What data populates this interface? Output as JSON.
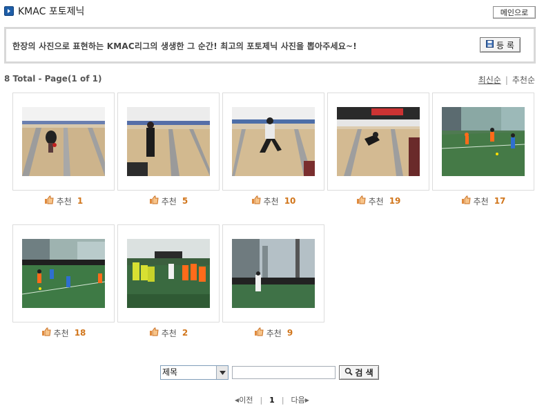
{
  "header": {
    "title": "KMAC 포토제닉",
    "main_button": "메인으로"
  },
  "notice": {
    "text": "한장의 사진으로 표현하는 KMAC리그의 생생한 그 순간!  최고의 포토제닉 사진을 뽑아주세요~!",
    "register_button": "등 록"
  },
  "summary": {
    "count_text": "8 Total - Page(1 of 1)"
  },
  "sort": {
    "latest": "최신순",
    "separator": "|",
    "recommended": "추천순"
  },
  "photos": [
    {
      "scene": "bowling",
      "rec_label": "추천",
      "rec_count": "1"
    },
    {
      "scene": "bowling",
      "rec_label": "추천",
      "rec_count": "5"
    },
    {
      "scene": "bowling",
      "rec_label": "추천",
      "rec_count": "10"
    },
    {
      "scene": "bowling",
      "rec_label": "추천",
      "rec_count": "19"
    },
    {
      "scene": "futsal",
      "rec_label": "추천",
      "rec_count": "17"
    },
    {
      "scene": "futsal",
      "rec_label": "추천",
      "rec_count": "18"
    },
    {
      "scene": "futsal",
      "rec_label": "추천",
      "rec_count": "2"
    },
    {
      "scene": "futsal",
      "rec_label": "추천",
      "rec_count": "9"
    }
  ],
  "search": {
    "field_selected": "제목",
    "input_value": "",
    "button": "검 색"
  },
  "pager": {
    "prev": "이전",
    "current": "1",
    "separator": "|",
    "next": "다음"
  },
  "colors": {
    "accent_count": "#d1761c",
    "title_icon": "#1e5ea8"
  }
}
